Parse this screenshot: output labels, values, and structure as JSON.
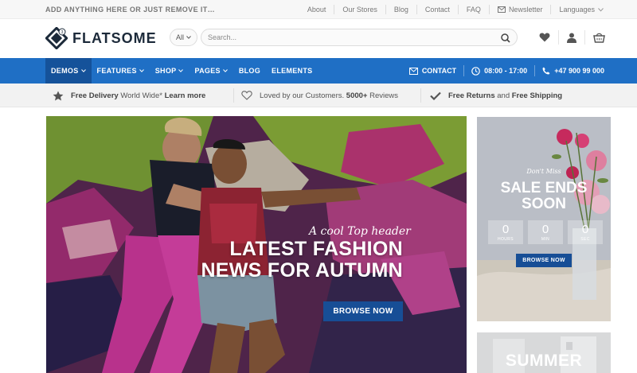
{
  "topbar": {
    "message": "ADD ANYTHING HERE OR JUST REMOVE IT…",
    "links": [
      "About",
      "Our Stores",
      "Blog",
      "Contact",
      "FAQ"
    ],
    "newsletter": "Newsletter",
    "languages": "Languages"
  },
  "header": {
    "logo_text": "FLATSOME",
    "search": {
      "category": "All",
      "placeholder": "Search..."
    },
    "icons": [
      "heart-icon",
      "user-icon",
      "cart-icon"
    ]
  },
  "mainnav": {
    "items": [
      {
        "label": "DEMOS",
        "has_dropdown": true,
        "active": true
      },
      {
        "label": "FEATURES",
        "has_dropdown": true
      },
      {
        "label": "SHOP",
        "has_dropdown": true
      },
      {
        "label": "PAGES",
        "has_dropdown": true
      },
      {
        "label": "BLOG",
        "has_dropdown": false
      },
      {
        "label": "ELEMENTS",
        "has_dropdown": false
      }
    ],
    "contact": "CONTACT",
    "hours": "08:00 - 17:00",
    "phone": "+47 900 99 000",
    "accent_color": "#1f6fc5",
    "active_color": "#15529a"
  },
  "infobar": {
    "delivery": {
      "prefix": "Free Delivery",
      "middle": " World Wide* ",
      "link": "Learn more"
    },
    "loved": {
      "text": "Loved by our Customers. ",
      "bold": "5000+",
      "suffix": " Reviews"
    },
    "returns": {
      "a": "Free Returns",
      "and": " and ",
      "b": "Free Shipping"
    }
  },
  "hero": {
    "kicker": "A cool Top header",
    "title_line1": "LATEST FASHION",
    "title_line2": "NEWS FOR AUTUMN",
    "button": "BROWSE NOW"
  },
  "sale_panel": {
    "kicker": "Don't Miss",
    "headline_line1": "SALE ENDS",
    "headline_line2": "SOON",
    "countdown": [
      {
        "value": "0",
        "unit": "HOURS"
      },
      {
        "value": "0",
        "unit": "MIN"
      },
      {
        "value": "0",
        "unit": "SEC"
      }
    ],
    "button": "BROWSE NOW"
  },
  "summer_panel": {
    "headline": "SUMMER"
  }
}
